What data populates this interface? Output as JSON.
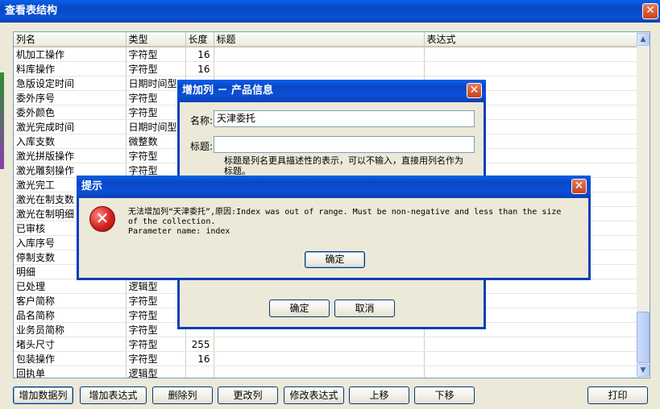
{
  "main": {
    "title": "查看表结构",
    "columns": [
      "列名",
      "类型",
      "长度",
      "标题",
      "表达式"
    ],
    "rows": [
      {
        "name": "机加工操作",
        "type": "字符型",
        "len": "16"
      },
      {
        "name": "料库操作",
        "type": "字符型",
        "len": "16"
      },
      {
        "name": "急版设定时间",
        "type": "日期时间型",
        "len": ""
      },
      {
        "name": "委外序号",
        "type": "字符型",
        "len": ""
      },
      {
        "name": "委外颜色",
        "type": "字符型",
        "len": ""
      },
      {
        "name": "激光完成时间",
        "type": "日期时间型",
        "len": ""
      },
      {
        "name": "入库支数",
        "type": "微整数",
        "len": ""
      },
      {
        "name": "激光拼版操作",
        "type": "字符型",
        "len": ""
      },
      {
        "name": "激光雕刻操作",
        "type": "字符型",
        "len": ""
      },
      {
        "name": "激光完工",
        "type": "",
        "len": ""
      },
      {
        "name": "激光在制支数",
        "type": "",
        "len": ""
      },
      {
        "name": "激光在制明细",
        "type": "",
        "len": ""
      },
      {
        "name": "已审核",
        "type": "",
        "len": ""
      },
      {
        "name": "入库序号",
        "type": "",
        "len": ""
      },
      {
        "name": "停制支数",
        "type": "",
        "len": ""
      },
      {
        "name": "明细",
        "type": "",
        "len": ""
      },
      {
        "name": "已处理",
        "type": "逻辑型",
        "len": ""
      },
      {
        "name": "客户简称",
        "type": "字符型",
        "len": ""
      },
      {
        "name": "品名简称",
        "type": "字符型",
        "len": ""
      },
      {
        "name": "业务员简称",
        "type": "字符型",
        "len": ""
      },
      {
        "name": "堵头尺寸",
        "type": "字符型",
        "len": "255"
      },
      {
        "name": "包装操作",
        "type": "字符型",
        "len": "16"
      },
      {
        "name": "回执单",
        "type": "逻辑型",
        "len": ""
      }
    ],
    "buttons": {
      "add_data_col": "增加数据列",
      "add_expr": "增加表达式",
      "delete_col": "删除列",
      "change_col": "更改列",
      "edit_expr": "修改表达式",
      "move_up": "上移",
      "move_down": "下移",
      "print": "打印"
    }
  },
  "add_dialog": {
    "title": "增加列 － 产品信息",
    "name_label": "名称:",
    "name_value": "天津委托",
    "caption_label": "标题:",
    "caption_value": "",
    "hint": "标题是列名更具描述性的表示，可以不输入，直接用列名作为标题。",
    "ok": "确定",
    "cancel": "取消"
  },
  "alert": {
    "title": "提示",
    "message_line1": "无法增加列“天津委托”,原因:Index was out of range. Must be non-negative and less than the size",
    "message_line2": "of the collection.",
    "message_line3": "Parameter name: index",
    "ok": "确定"
  },
  "colors": {
    "title_blue": "#0a4fd4",
    "close_red": "#c8421c",
    "error_red": "#d42020",
    "desktop": "#3a6ea5"
  }
}
